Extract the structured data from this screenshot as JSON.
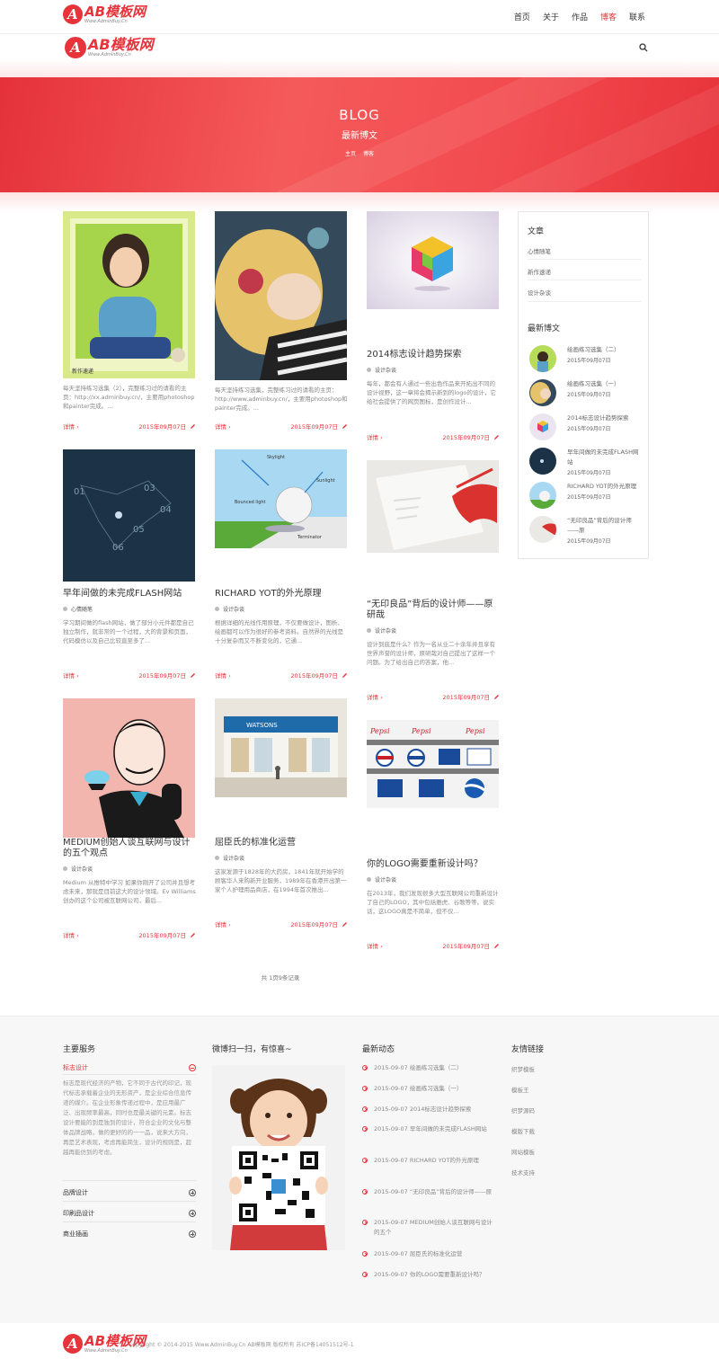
{
  "brand": {
    "logo_text": "AB模板网",
    "logo_sub": "Www.AdminBuy.Cn"
  },
  "nav": {
    "items": [
      "首页",
      "关于",
      "作品",
      "博客",
      "联系"
    ],
    "active_index": 3
  },
  "banner": {
    "title": "BLOG",
    "subtitle": "最新博文",
    "crumbs": [
      "主页",
      "博客"
    ]
  },
  "posts": [
    {
      "title": "",
      "category": "新作速递",
      "desc": "每天坚持练习选集（2），完整练习过的请看的主页：http://xx.adminbuy.cn/，主要用photoshop和painter完成。...",
      "more": "详情",
      "date": "2015年09月07日"
    },
    {
      "title": "",
      "category": "",
      "desc": "每天坚持练习选集，完整练习过的请看的主页：http://www.adminbuy.cn/，主要用photoshop和painter完成。...",
      "more": "详情",
      "date": "2015年09月07日"
    },
    {
      "title": "2014标志设计趋势探索",
      "category": "设计杂谈",
      "desc": "每年，都会有人通过一些出色作品来开拓出不同的设计视野，这一章将会揭示新到的logo的设计，它给社会提供了的网页图标，是创作设计...",
      "more": "详情",
      "date": "2015年09月07日"
    },
    {
      "title": "早年间做的未完成FLASH网站",
      "category": "心情随笔",
      "desc": "学习期间做的flash网站，做了部分小元件都是自己独立制作，就非常的一个过程，大的背景和页面，代码模仿以及自己比较直至多了...",
      "more": "详情",
      "date": "2015年09月07日"
    },
    {
      "title": "RICHARD YOT的外光原理",
      "category": "设计杂谈",
      "desc": "根据详细的光线作用原理，不仅要做设计，图析、绘画都可以作为很好的参考资料。自然界的光线是十分复杂而又不断变化的，它通...",
      "more": "详情",
      "date": "2015年09月07日"
    },
    {
      "title": "“无印良品”背后的设计师——原研哉",
      "category": "设计杂谈",
      "desc": "设计到底是什么？作为一名从业二十余年并且享有世界声誉的设计师，原研哉对自己提出了这样一个问题。为了给出自己的答案，他...",
      "more": "详情",
      "date": "2015年09月07日"
    },
    {
      "title": "MEDIUM创始人谈互联网与设计的五个观点",
      "category": "设计杂谈",
      "desc": "Medium 从推特中学习 如果你刚开了公司并且想考虑未来，那就是目前这大的设计领域。Ev Williams创办的这个公司被互联网公司，最后...",
      "more": "详情",
      "date": "2015年09月07日"
    },
    {
      "title": "屈臣氏的标准化运营",
      "category": "设计杂谈",
      "desc": "这家发源于1828年的大药房，1841年就开始学的顾客华人来购新开业服务，1989年在香港开出第一家个人护理用品商店，在1994年首次推出...",
      "more": "详情",
      "date": "2015年09月07日"
    },
    {
      "title": "你的LOGO需要重新设计吗？",
      "category": "设计杂谈",
      "desc": "在2013年，我们发现很多大型互联网公司重新设计了自己的LOGO，其中包括雅虎、谷歌等等。说实话，这LOGO真是不简单，但不仅...",
      "more": "详情",
      "date": "2015年09月07日"
    }
  ],
  "pager": "共 1页9条记录",
  "sidebar": {
    "categories_title": "文章",
    "categories": [
      "心情随笔",
      "新作速递",
      "设计杂谈"
    ],
    "recent_title": "最新博文",
    "recent": [
      {
        "title": "绘画练习选集（二）",
        "date": "2015年09月07日"
      },
      {
        "title": "绘画练习选集（一）",
        "date": "2015年09月07日"
      },
      {
        "title": "2014标志设计趋势探索",
        "date": "2015年09月07日"
      },
      {
        "title": "早年间做的未完成FLASH网站",
        "date": "2015年09月07日"
      },
      {
        "title": "RICHARD YOT的外光原理",
        "date": "2015年09月07日"
      },
      {
        "title": "“无印良品”背后的设计师——原",
        "date": "2015年09月07日"
      }
    ]
  },
  "footer": {
    "services_title": "主要服务",
    "services": [
      {
        "label": "标志设计",
        "text": "标志是现代经济的产物，它不同于古代的印记，现代标志承载着企业的无形资产，是企业综合信息传递的媒介。在企业形象传递过程中，是应用最广泛、出现频率最高，同时也是最关键的元素。标志设计要能的到是独到的设计，符合企业的文化与整体品牌战略，做的更好的的一一品，说来大方向，再是艺术表现，考虑再能简生，设计的规则是，超越再能仿到的考虑。"
      },
      {
        "label": "品牌设计",
        "text": ""
      },
      {
        "label": "印刷品设计",
        "text": ""
      },
      {
        "label": "商业插画",
        "text": ""
      }
    ],
    "weibo_title": "微博扫一扫，有惊喜~",
    "news_title": "最新动态",
    "news": [
      "2015-09-07  绘画练习选集（二）",
      "2015-09-07  绘画练习选集（一）",
      "2015-09-07  2014标志设计趋势探索",
      "2015-09-07  早年间做的未完成FLASH网站",
      "2015-09-07  RICHARD YOT的外光原理",
      "2015-09-07  “无印良品”背后的设计师——原",
      "2015-09-07  MEDIUM创始人谈互联网与设计的五个",
      "2015-09-07  屈臣氏的标准化运营",
      "2015-09-07  你的LOGO需要重新设计吗？"
    ],
    "links_title": "友情链接",
    "links": [
      "织梦模板",
      "模板王",
      "织梦源码",
      "模版下载",
      "网站模板",
      "技术支持"
    ],
    "copyright": "Copyright © 2014-2015 Www.AdminBuy.Cn AB模板网 版权所有  苏ICP备14051512号-1"
  },
  "colors": {
    "accent": "#e8333a",
    "banner": "#f05050"
  }
}
